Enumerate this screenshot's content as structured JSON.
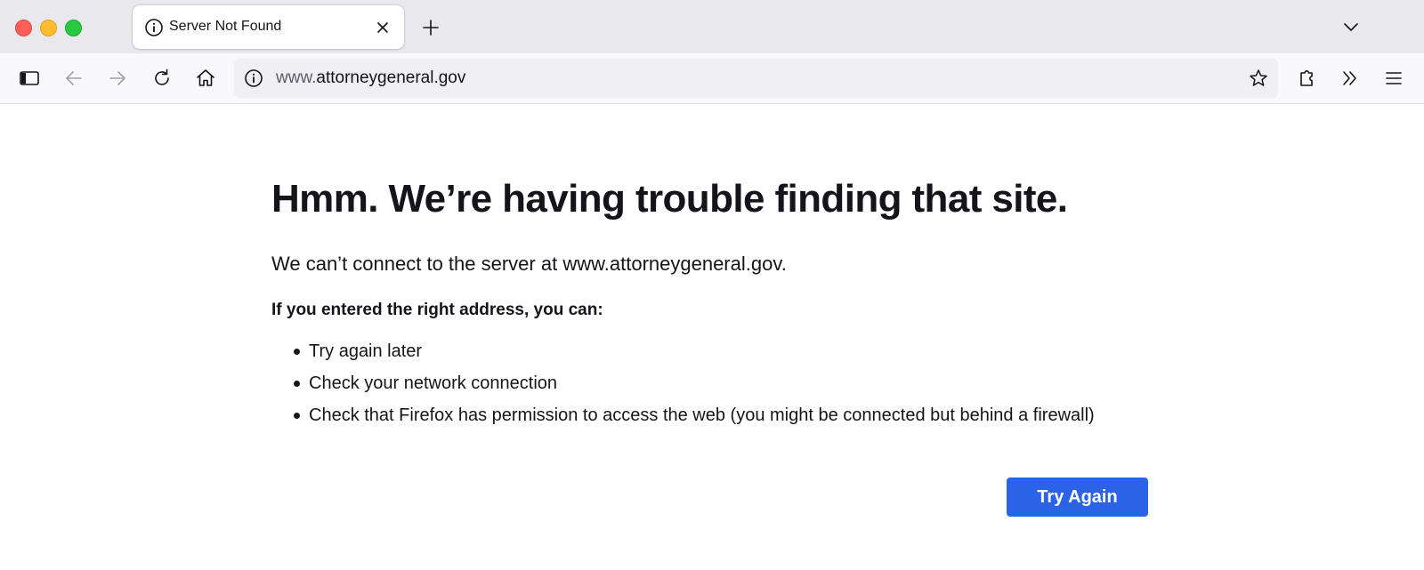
{
  "window": {
    "controls": [
      "close",
      "minimize",
      "maximize"
    ]
  },
  "tab": {
    "title": "Server Not Found",
    "icon": "info-icon"
  },
  "toolbar": {
    "icons": [
      "sidebar-icon",
      "back-arrow-icon",
      "forward-arrow-icon",
      "reload-icon",
      "home-icon",
      "bookmark-star-icon",
      "extensions-icon",
      "overflow-chevrons-icon",
      "menu-icon"
    ]
  },
  "urlbar": {
    "prefix": "www.",
    "domain": "attorneygeneral.gov"
  },
  "error": {
    "heading": "Hmm. We’re having trouble finding that site.",
    "message": "We can’t connect to the server at www.attorneygeneral.gov.",
    "subheading": "If you entered the right address, you can:",
    "suggestions": [
      "Try again later",
      "Check your network connection",
      "Check that Firefox has permission to access the web (you might be connected but behind a firewall)"
    ],
    "button_label": "Try Again"
  },
  "colors": {
    "accent": "#2b63e8",
    "titlebar": "#e9e9ed",
    "toolbar": "#f9f9fb"
  }
}
